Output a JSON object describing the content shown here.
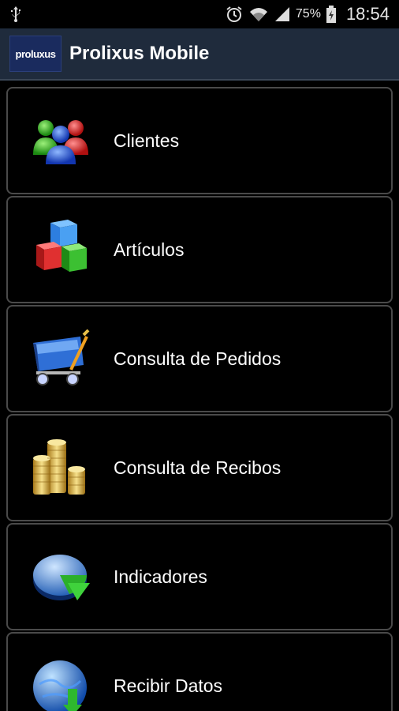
{
  "status_bar": {
    "battery_percent": "75%",
    "time": "18:54",
    "icons": [
      "usb-icon",
      "alarm-icon",
      "wifi-icon",
      "signal-icon",
      "battery-icon"
    ]
  },
  "action_bar": {
    "logo_text": "proluxus",
    "title": "Prolixus Mobile"
  },
  "menu": {
    "items": [
      {
        "label": "Clientes",
        "icon": "users-icon"
      },
      {
        "label": "Artículos",
        "icon": "boxes-icon"
      },
      {
        "label": "Consulta de Pedidos",
        "icon": "shopping-cart-icon"
      },
      {
        "label": "Consulta de Recibos",
        "icon": "coins-icon"
      },
      {
        "label": "Indicadores",
        "icon": "pie-chart-icon"
      },
      {
        "label": "Recibir Datos",
        "icon": "globe-download-icon"
      }
    ]
  }
}
